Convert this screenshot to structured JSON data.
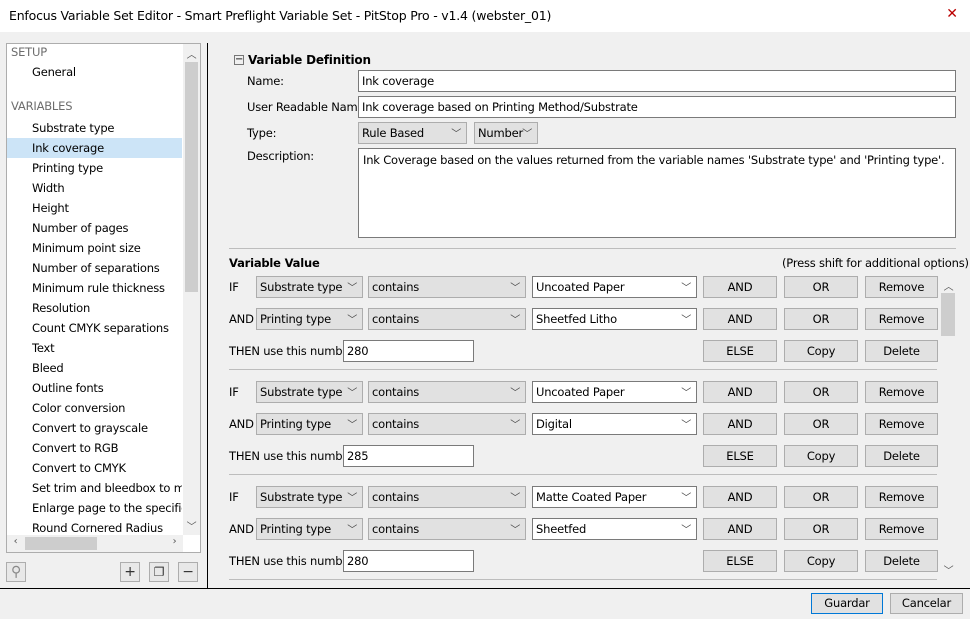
{
  "window": {
    "title": "Enfocus Variable Set Editor - Smart Preflight Variable Set - PitStop Pro - v1.4 (webster_01)",
    "close_icon": "close-icon"
  },
  "sidebar": {
    "setup_header": "SETUP",
    "setup_items": [
      "General"
    ],
    "variables_header": "VARIABLES",
    "items": [
      "Substrate type",
      "Ink coverage",
      "Printing type",
      "Width",
      "Height",
      "Number of pages",
      "Minimum point size",
      "Number of separations",
      "Minimum rule thickness",
      "Resolution",
      "Count CMYK separations",
      "Text",
      "Bleed",
      "Outline fonts",
      "Color conversion",
      "Convert to grayscale",
      "Convert to RGB",
      "Convert to CMYK",
      "Set trim and bleedbox to ma",
      "Enlarge page to the specifiec",
      "Round Cornered Radius"
    ],
    "selected": "Ink coverage",
    "toolbar": {
      "search": "search-icon",
      "add": "+",
      "duplicate": "duplicate-icon",
      "remove": "−"
    }
  },
  "definition": {
    "header": "Variable Definition",
    "name_label": "Name:",
    "name_value": "Ink coverage",
    "urn_label": "User Readable Name:",
    "urn_value": "Ink coverage based on Printing Method/Substrate",
    "type_label": "Type:",
    "type_value": "Rule Based",
    "subtype_value": "Number",
    "desc_label": "Description:",
    "desc_value": "Ink Coverage based on the values returned from the variable names 'Substrate type' and 'Printing type'."
  },
  "value": {
    "header": "Variable Value",
    "hint": "(Press shift for additional options)",
    "then_label": "THEN use this number:",
    "buttons": {
      "and": "AND",
      "or": "OR",
      "remove": "Remove",
      "else": "ELSE",
      "copy": "Copy",
      "delete": "Delete"
    },
    "rules": [
      {
        "conditions": [
          {
            "prefix": "IF",
            "variable": "Substrate type",
            "operator": "contains",
            "value": "Uncoated Paper"
          },
          {
            "prefix": "AND",
            "variable": "Printing type",
            "operator": "contains",
            "value": "Sheetfed Litho"
          }
        ],
        "result": "280"
      },
      {
        "conditions": [
          {
            "prefix": "IF",
            "variable": "Substrate type",
            "operator": "contains",
            "value": "Uncoated Paper"
          },
          {
            "prefix": "AND",
            "variable": "Printing type",
            "operator": "contains",
            "value": "Digital"
          }
        ],
        "result": "285"
      },
      {
        "conditions": [
          {
            "prefix": "IF",
            "variable": "Substrate type",
            "operator": "contains",
            "value": "Matte Coated Paper"
          },
          {
            "prefix": "AND",
            "variable": "Printing type",
            "operator": "contains",
            "value": "Sheetfed"
          }
        ],
        "result": "280"
      }
    ]
  },
  "footer": {
    "ok": "Guardar",
    "cancel": "Cancelar"
  }
}
